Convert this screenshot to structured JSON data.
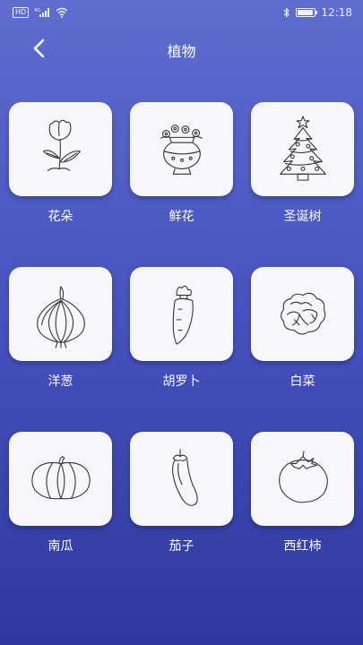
{
  "status_bar": {
    "left_badges": [
      "HD",
      "4G"
    ],
    "time": "12:18",
    "battery_level": 0.9,
    "icons": [
      "hd-badge",
      "signal-icon",
      "wifi-icon",
      "bluetooth-icon",
      "battery-icon"
    ]
  },
  "header": {
    "title": "植物",
    "back_icon": "chevron-left-icon"
  },
  "items": [
    {
      "label": "花朵",
      "icon": "flower-drawing"
    },
    {
      "label": "鲜花",
      "icon": "flower-vase-drawing"
    },
    {
      "label": "圣诞树",
      "icon": "christmas-tree-drawing"
    },
    {
      "label": "洋葱",
      "icon": "onion-drawing"
    },
    {
      "label": "胡罗卜",
      "icon": "carrot-drawing"
    },
    {
      "label": "白菜",
      "icon": "cabbage-drawing"
    },
    {
      "label": "南瓜",
      "icon": "pumpkin-drawing"
    },
    {
      "label": "茄子",
      "icon": "eggplant-drawing"
    },
    {
      "label": "西红柿",
      "icon": "tomato-drawing"
    }
  ],
  "colors": {
    "background_top": "#5e6dcf",
    "background_bottom": "#2f389e",
    "card": "#f6f6fb",
    "text": "#ffffff"
  }
}
